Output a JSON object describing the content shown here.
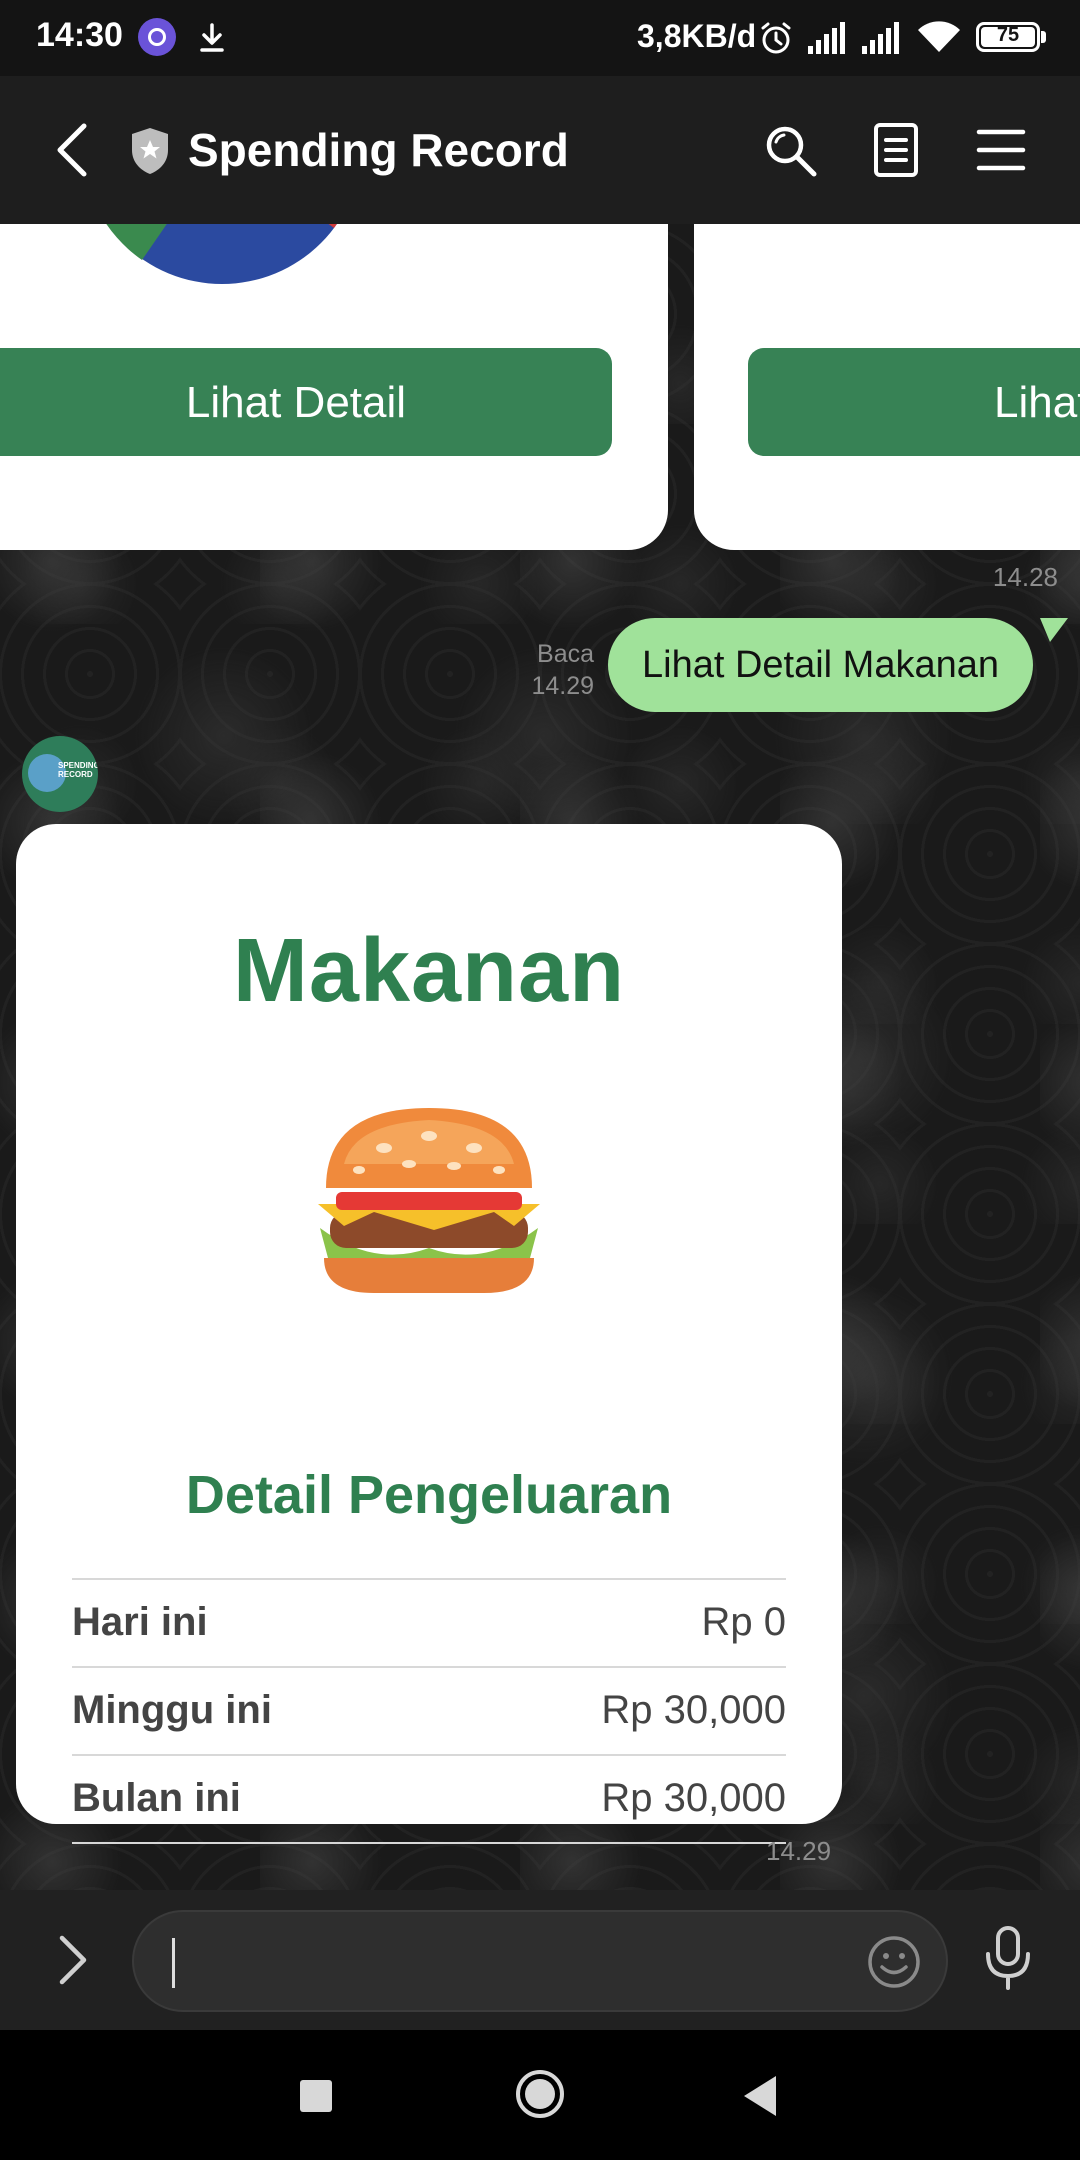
{
  "status_bar": {
    "time": "14:30",
    "net_speed": "3,8KB/d",
    "battery": "75"
  },
  "header": {
    "title": "Spending Record"
  },
  "chat": {
    "carousel": {
      "button_left": "Lihat Detail",
      "button_right": "Lihat Detail",
      "timestamp": "14.28"
    },
    "outgoing": {
      "read_label": "Baca",
      "timestamp": "14.29",
      "text": "Lihat Detail Makanan"
    },
    "bot": {
      "avatar_text_line1": "SPENDING",
      "avatar_text_line2": "RECORD"
    },
    "card": {
      "title": "Makanan",
      "section_title": "Detail Pengeluaran",
      "rows": [
        {
          "label": "Hari ini",
          "value": "Rp 0"
        },
        {
          "label": "Minggu ini",
          "value": "Rp 30,000"
        },
        {
          "label": "Bulan ini",
          "value": "Rp 30,000"
        }
      ],
      "timestamp": "14.29"
    }
  },
  "input": {
    "value": ""
  },
  "colors": {
    "accent_green": "#378255",
    "title_green": "#2f8050",
    "bubble_green": "#a0e29a"
  },
  "icons": [
    "download-icon",
    "alarm-icon",
    "signal-icon",
    "wifi-icon",
    "battery-icon",
    "back-arrow-icon",
    "shield-icon",
    "search-icon",
    "notes-icon",
    "menu-icon",
    "expand-icon",
    "emoji-icon",
    "microphone-icon",
    "burger-icon"
  ]
}
